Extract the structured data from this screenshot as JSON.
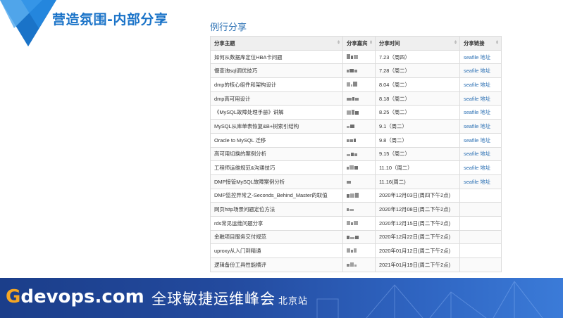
{
  "slide": {
    "title": "营造氛围-内部分享",
    "section_title": "例行分享"
  },
  "table": {
    "headers": [
      "分享主题",
      "分享嘉宾",
      "分享时间",
      "分享链接"
    ],
    "rows": [
      {
        "topic": "如何从数据库定位HBA卡问题",
        "time": "7.23（周四）",
        "link": "seafile 地址"
      },
      {
        "topic": "慢查询sql调优技巧",
        "time": "7.28（周二）",
        "link": "seafile 地址"
      },
      {
        "topic": "dmp的核心组件和架构设计",
        "time": "8.04（周二）",
        "link": "seafile 地址"
      },
      {
        "topic": "dmp高可用设计",
        "time": "8.18（周二）",
        "link": "seafile 地址"
      },
      {
        "topic": "《MySQL故障处理手册》讲解",
        "time": "8.25（周二）",
        "link": "seafile 地址"
      },
      {
        "topic": "MySQL从库单表恢复&B+树索引结构",
        "time": "9.1（周二）",
        "link": "seafile 地址"
      },
      {
        "topic": "Oracle to MySQL 迁移",
        "time": "9.8（周二）",
        "link": "seafile 地址"
      },
      {
        "topic": "高可用切换的案例分析",
        "time": "9.15（周二）",
        "link": "seafile 地址"
      },
      {
        "topic": "工程师运维规范&沟通技巧",
        "time": "11.10（周二）",
        "link": "seafile 地址"
      },
      {
        "topic": "DMP接管MySQL故障案例分析",
        "time": "11.16(周二)",
        "link": "seafile 地址"
      },
      {
        "topic": "DMP监控异常之-Seconds_Behind_Master的取值",
        "time": "2020年12月03日(周四下午2点)",
        "link": ""
      },
      {
        "topic": "网页http场景问题定位方法",
        "time": "2020年12月08日(周二下午2点)",
        "link": ""
      },
      {
        "topic": "rds常见运维问题分享",
        "time": "2020年12月15日(周二下午2点)",
        "link": ""
      },
      {
        "topic": "金融项目服务交付规范",
        "time": "2020年12月22日(周二下午2点)",
        "link": ""
      },
      {
        "topic": "uproxy从入门到精通",
        "time": "2020年01月12日(周二下午2点)",
        "link": ""
      },
      {
        "topic": "逻辑备份工具性能横评",
        "time": "2021年01月19日(周二下午2点)",
        "link": ""
      }
    ]
  },
  "footer": {
    "brand_g": "G",
    "brand_rest": "devops.com",
    "event": "全球敏捷运维峰会",
    "city": "北京站"
  },
  "colors": {
    "accent_blue": "#1a73c8",
    "link_blue": "#2a6fb3",
    "brand_orange": "#f5a623",
    "footer_blue": "#234a9e"
  }
}
